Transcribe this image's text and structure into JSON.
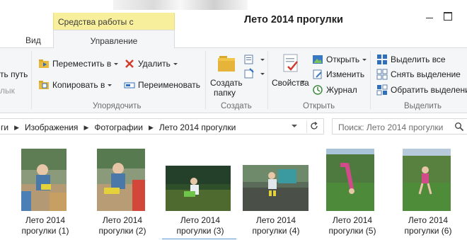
{
  "window": {
    "title": "Лето 2014 прогулки",
    "context_tab_header": "Средства работы с рисунками"
  },
  "tabs": {
    "view": "Вид",
    "manage": "Управление"
  },
  "ribbon": {
    "clipboard": {
      "copy_path": "ть путь",
      "paste_shortcut": "лык"
    },
    "organize": {
      "label": "Упорядочить",
      "move_to": "Переместить в",
      "copy_to": "Копировать в",
      "delete": "Удалить",
      "rename": "Переименовать"
    },
    "create": {
      "label": "Создать",
      "new_folder_line1": "Создать",
      "new_folder_line2": "папку"
    },
    "open": {
      "label": "Открыть",
      "properties": "Свойства",
      "open": "Открыть",
      "edit": "Изменить",
      "history": "Журнал"
    },
    "select": {
      "label": "Выделить",
      "select_all": "Выделить все",
      "select_none": "Снять выделение",
      "invert_selection": "Обратить выделение"
    }
  },
  "address": {
    "prefix": "ги",
    "crumbs": [
      "Изображения",
      "Фотографии",
      "Лето 2014 прогулки"
    ],
    "search_placeholder": "Поиск: Лето 2014 прогулки"
  },
  "files": [
    {
      "line1": "Лето 2014",
      "line2": "прогулки (1)"
    },
    {
      "line1": "Лето 2014",
      "line2": "прогулки (2)"
    },
    {
      "line1": "Лето 2014",
      "line2": "прогулки (3)"
    },
    {
      "line1": "Лето 2014",
      "line2": "прогулки (4)"
    },
    {
      "line1": "Лето 2014",
      "line2": "прогулки (5)"
    },
    {
      "line1": "Лето 2014",
      "line2": "прогулки (6)"
    }
  ],
  "colors": {
    "context_tab": "#f7ef9b",
    "ribbon_bg": "#f5f6f7",
    "focus_underline": "#5b9bd5",
    "delete_red": "#d23c2c",
    "select_blue": "#2f6fbd"
  }
}
